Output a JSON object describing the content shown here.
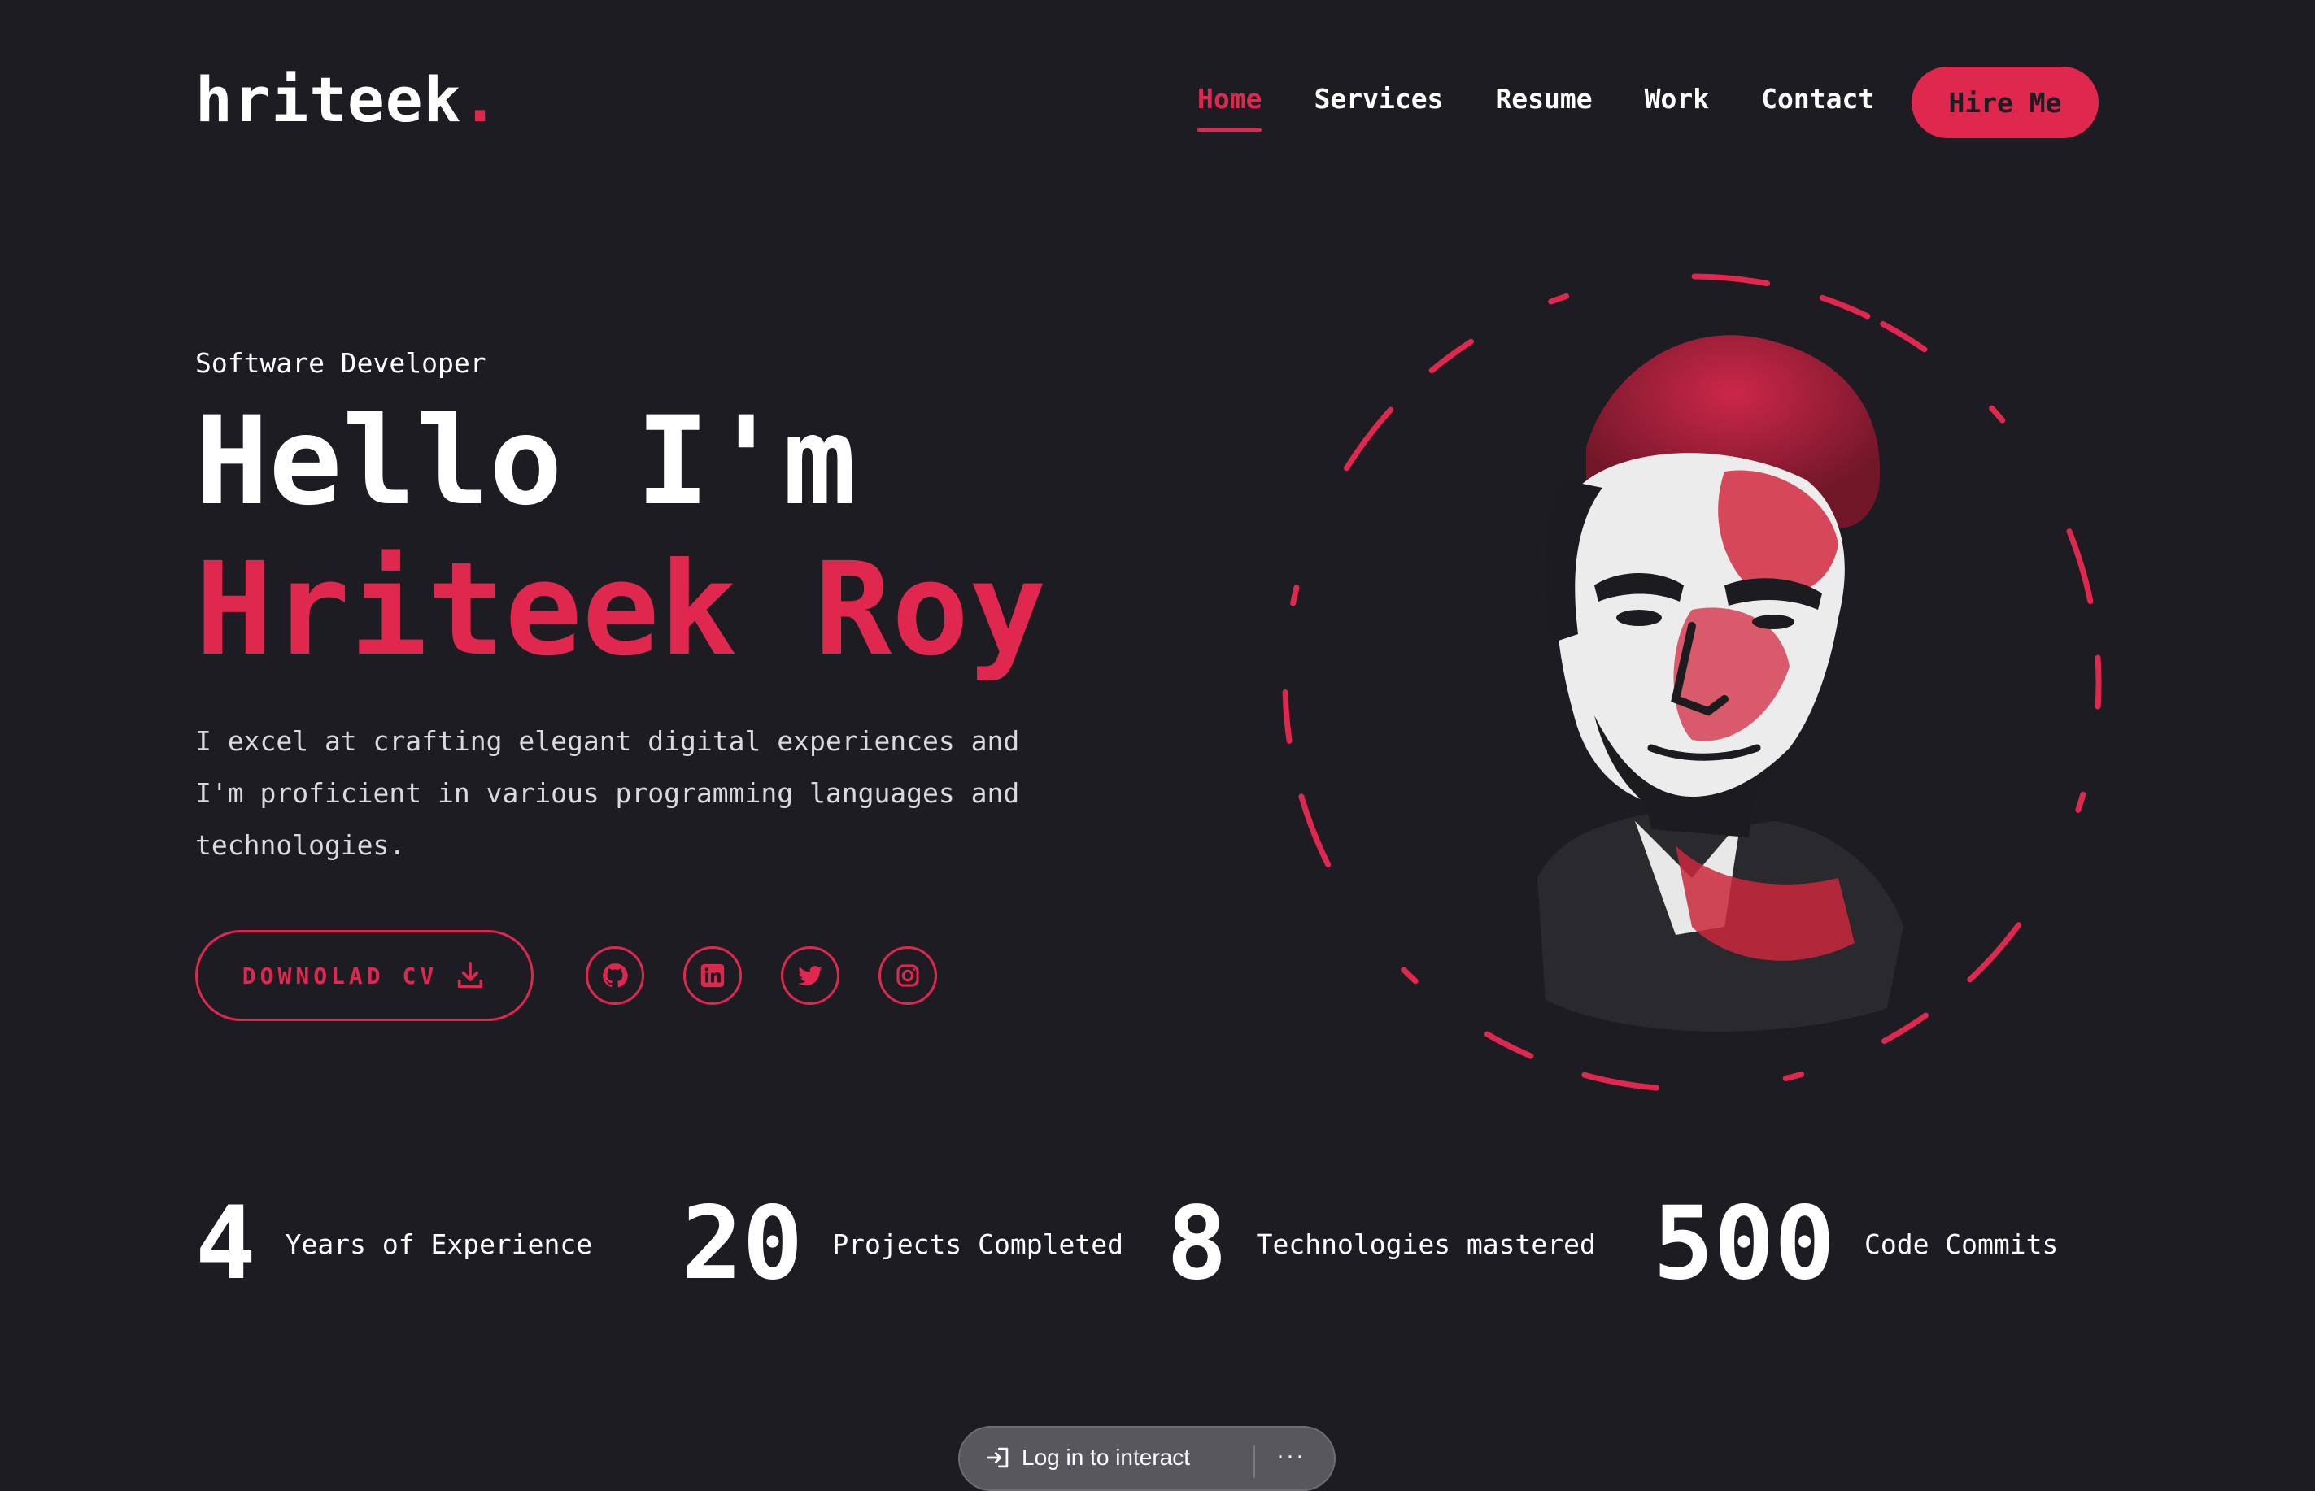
{
  "brand": {
    "logo_text": "hriteek",
    "logo_dot": ".",
    "accent_color": "#e0284f",
    "background_color": "#1d1c22"
  },
  "nav": {
    "items": [
      {
        "label": "Home",
        "active": true
      },
      {
        "label": "Services",
        "active": false
      },
      {
        "label": "Resume",
        "active": false
      },
      {
        "label": "Work",
        "active": false
      },
      {
        "label": "Contact",
        "active": false
      }
    ],
    "cta_label": "Hire Me"
  },
  "hero": {
    "subtitle": "Software Developer",
    "greeting": "Hello I'm",
    "name": "Hriteek Roy",
    "intro": "I excel at crafting elegant digital experiences and I'm proficient in various programming languages and technologies.",
    "download_label": "DOWNOLAD CV",
    "download_icon": "download-icon",
    "socials": [
      {
        "icon": "github-icon"
      },
      {
        "icon": "linkedin-icon"
      },
      {
        "icon": "twitter-icon"
      },
      {
        "icon": "instagram-icon"
      }
    ],
    "portrait": "portrait-image"
  },
  "stats": [
    {
      "value": "4",
      "label": "Years of Experience"
    },
    {
      "value": "20",
      "label": "Projects Completed"
    },
    {
      "value": "8",
      "label": "Technologies mastered"
    },
    {
      "value": "500",
      "label": "Code Commits"
    }
  ],
  "overlay": {
    "login_text": "Log in to interact",
    "more_label": "···"
  }
}
